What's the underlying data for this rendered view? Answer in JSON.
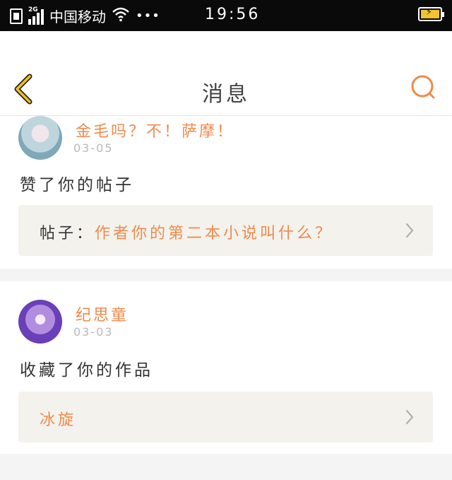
{
  "status_bar": {
    "network_type": "2G",
    "carrier": "中国移动",
    "more": "•••",
    "time": "19:56"
  },
  "header": {
    "title": "消息"
  },
  "notifications": [
    {
      "username": "金毛吗？不！萨摩！",
      "date": "03-05",
      "action": "赞了你的帖子",
      "ref_label": "帖子：",
      "ref_title": "作者你的第二本小说叫什么？"
    },
    {
      "username": "纪思童",
      "date": "03-03",
      "action": "收藏了你的作品",
      "ref_label": "",
      "ref_title": "冰旋"
    }
  ],
  "colors": {
    "accent": "#f08a4b",
    "back_icon": "#e8b820",
    "ref_background": "#f3f2ed"
  }
}
